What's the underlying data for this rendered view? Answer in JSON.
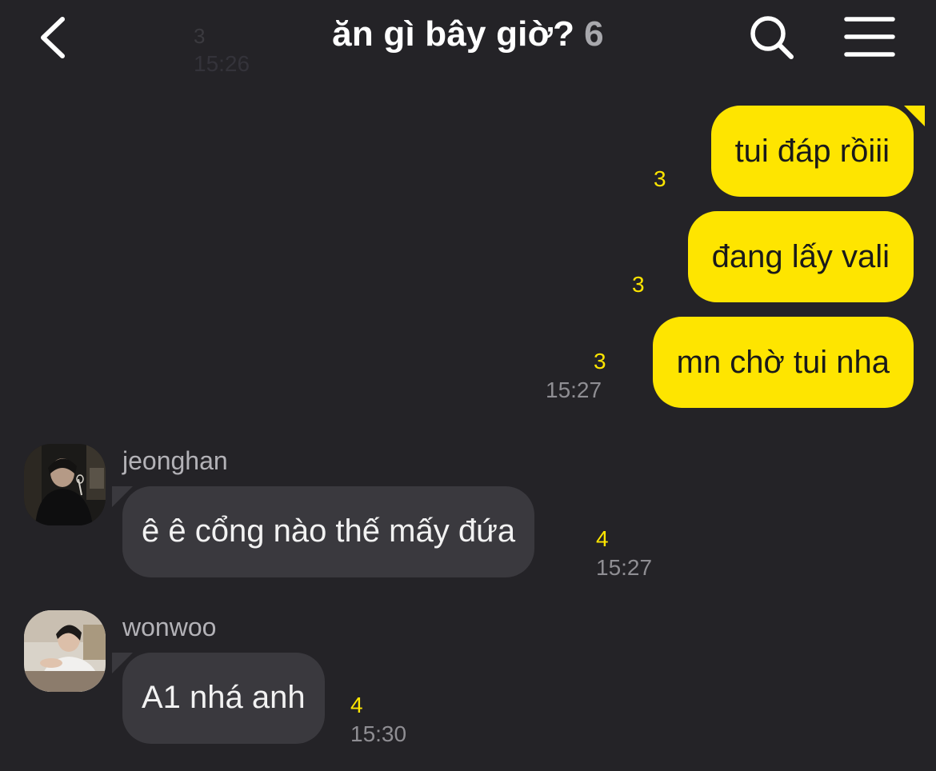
{
  "header": {
    "title": "ăn gì bây giờ?",
    "member_count": "6",
    "ghost_unread": "3",
    "ghost_time": "15:26",
    "back_icon": "chevron-left-icon",
    "search_icon": "search-icon",
    "menu_icon": "hamburger-menu-icon"
  },
  "colors": {
    "background": "#242327",
    "my_bubble": "#fee500",
    "their_bubble": "#3a393e",
    "unread": "#fee500"
  },
  "messages": [
    {
      "text": "tui đáp rồiii",
      "unread": "3"
    },
    {
      "text": "đang lấy vali",
      "unread": "3"
    },
    {
      "text": "mn chờ tui nha",
      "unread": "3",
      "time": "15:27"
    },
    {
      "sender": "jeonghan",
      "text": "ê ê cổng nào thế mấy đứa",
      "unread": "4",
      "time": "15:27"
    },
    {
      "sender": "wonwoo",
      "text": "A1 nhá anh",
      "unread": "4",
      "time": "15:30"
    }
  ]
}
